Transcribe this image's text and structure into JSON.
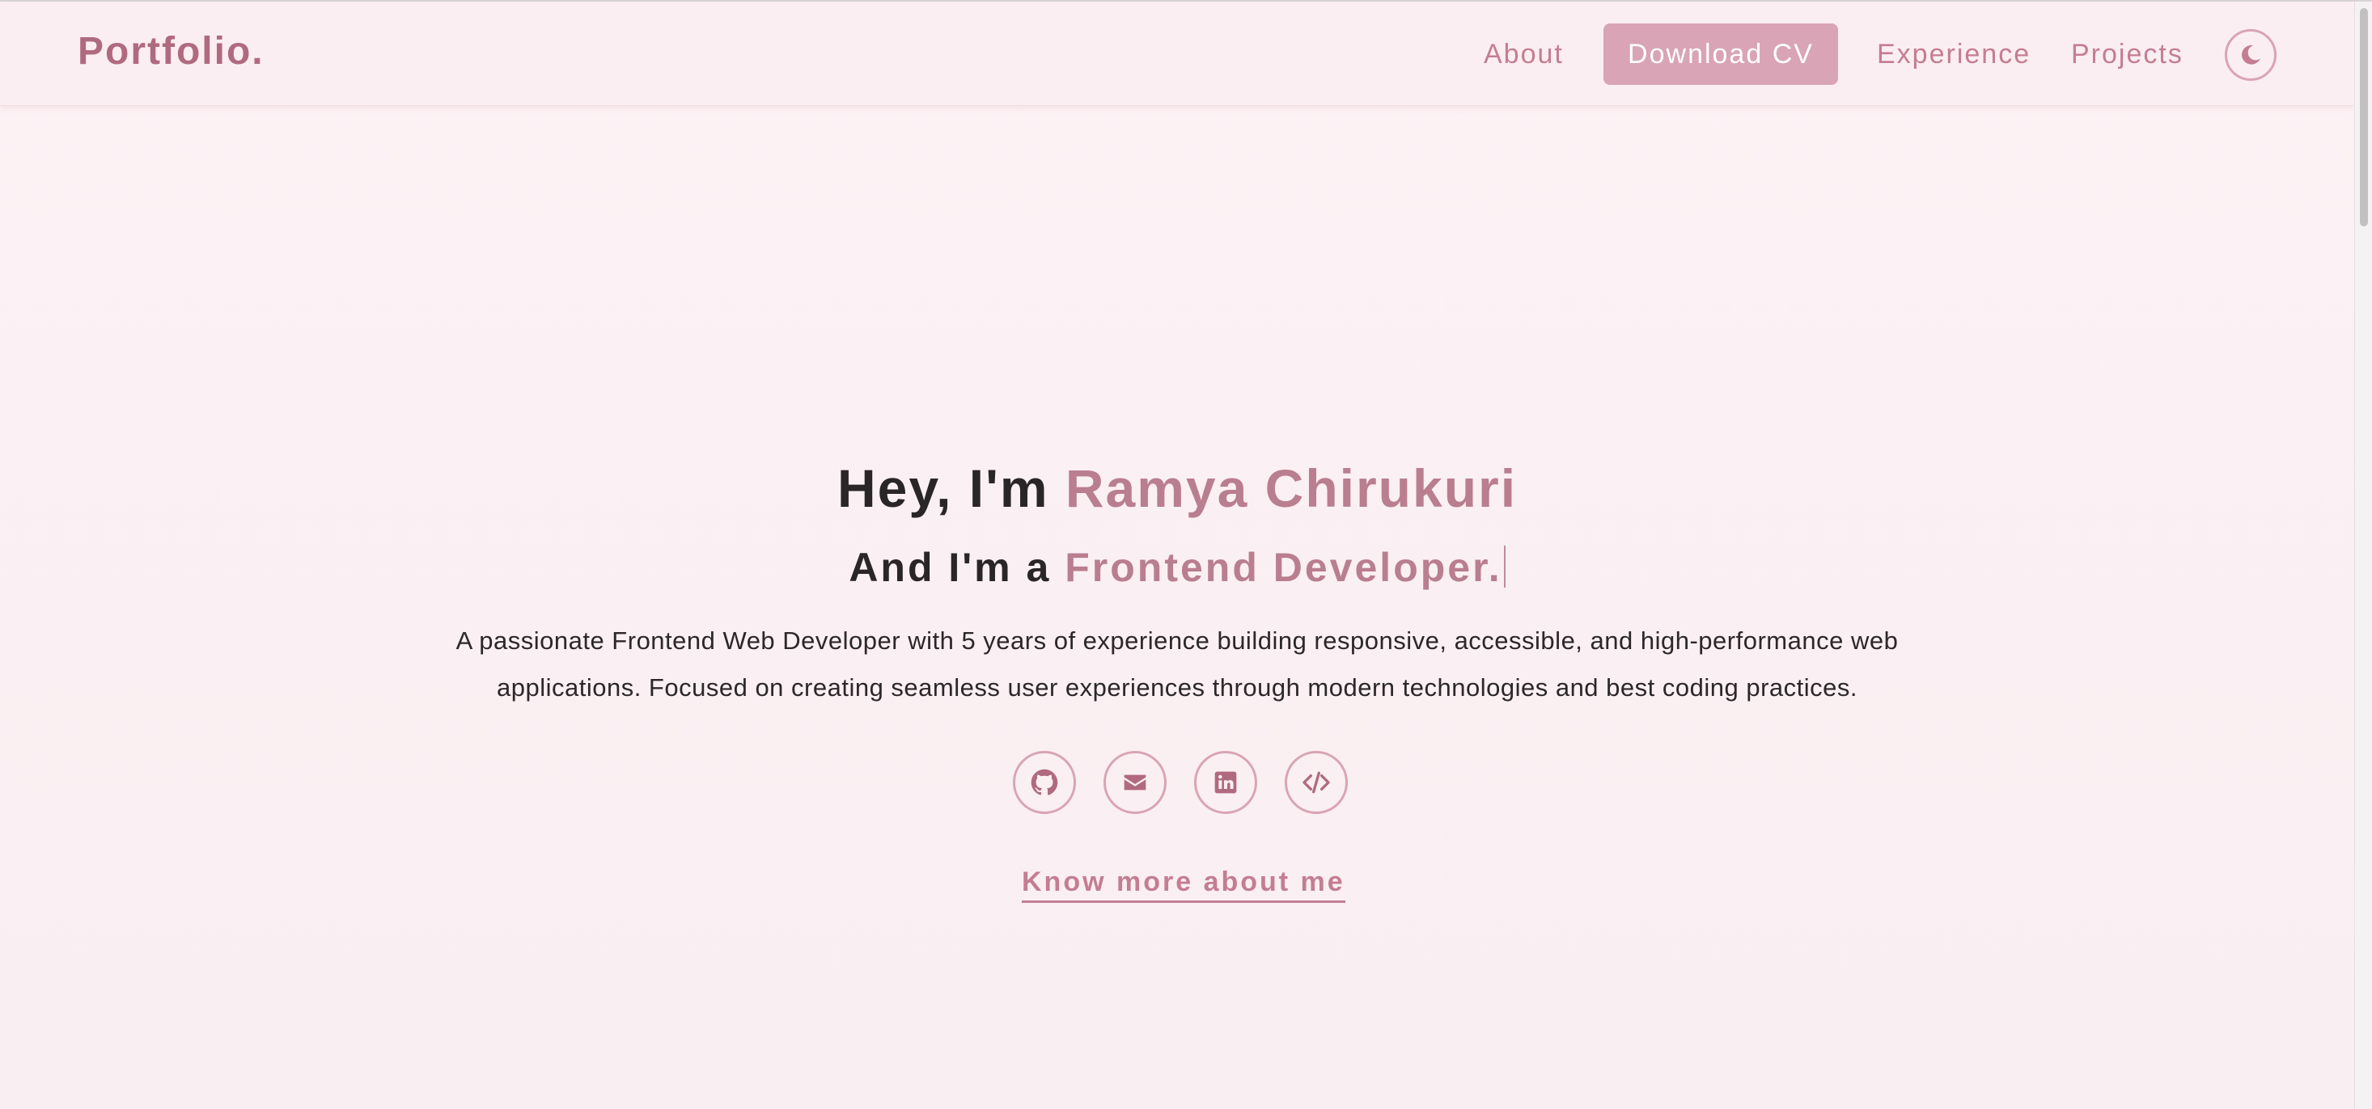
{
  "navbar": {
    "brand": "Portfolio.",
    "links": {
      "about": "About",
      "download_cv": "Download CV",
      "experience": "Experience",
      "projects": "Projects"
    },
    "theme_toggle_icon": "moon-icon"
  },
  "hero": {
    "greeting_prefix": "Hey, I'm",
    "name": "Ramya Chirukuri",
    "role_prefix": "And I'm a",
    "role": "Frontend Developer.",
    "description": "A passionate Frontend Web Developer with 5 years of experience building responsive, accessible, and high-performance web applications. Focused on creating seamless user experiences through modern technologies and best coding practices.",
    "social_icons": [
      "github-icon",
      "email-icon",
      "linkedin-icon",
      "code-icon"
    ],
    "know_more": "Know more about me"
  },
  "colors": {
    "accent": "#b97e8f",
    "link": "#c47d93",
    "button_bg": "#d9a4b5",
    "text": "#2a2527",
    "background": "#fdf2f5"
  }
}
